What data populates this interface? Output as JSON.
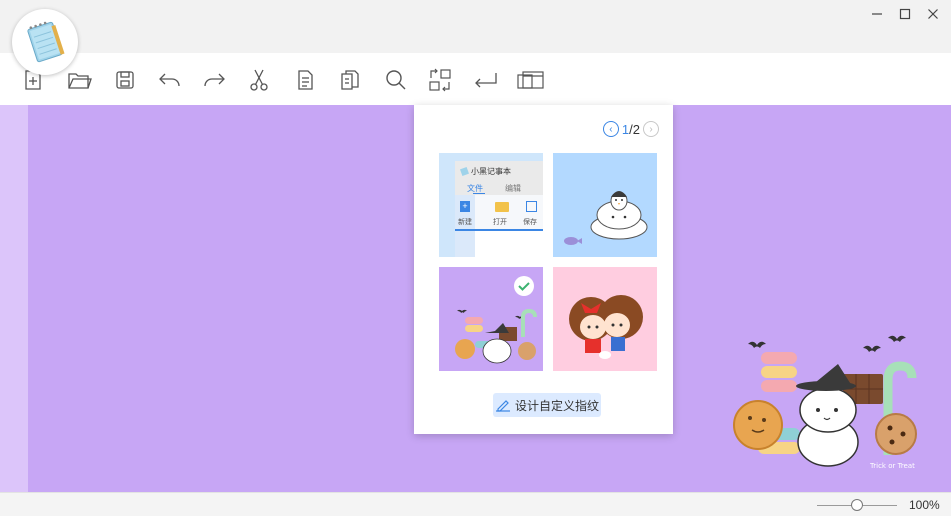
{
  "window": {
    "controls": [
      "minimize",
      "maximize",
      "close"
    ]
  },
  "app": {
    "logo_icon": "notepad-icon"
  },
  "toolbar": {
    "tools": [
      {
        "name": "new-button",
        "icon": "new-file-icon"
      },
      {
        "name": "open-button",
        "icon": "folder-open-icon"
      },
      {
        "name": "save-button",
        "icon": "save-icon"
      },
      {
        "name": "undo-button",
        "icon": "undo-icon"
      },
      {
        "name": "redo-button",
        "icon": "redo-icon"
      },
      {
        "name": "cut-button",
        "icon": "scissors-icon"
      },
      {
        "name": "copy-button",
        "icon": "document-icon"
      },
      {
        "name": "paste-button",
        "icon": "documents-icon"
      },
      {
        "name": "find-button",
        "icon": "search-icon"
      },
      {
        "name": "replace-button",
        "icon": "replace-icon"
      },
      {
        "name": "wrap-button",
        "icon": "enter-icon"
      },
      {
        "name": "skin-button",
        "icon": "windows-icon"
      }
    ]
  },
  "skin_panel": {
    "page": "1/2",
    "page_current": "1",
    "page_total": "/2",
    "thumb1": {
      "title": "小黑记事本",
      "tab_file": "文件",
      "tab_edit": "编辑",
      "btn_new": "新建",
      "btn_open": "打开",
      "btn_save": "保存"
    },
    "selected_index": 2,
    "design_button_label": "设计自定义指纹"
  },
  "editor": {
    "background": "#c7a6f5",
    "gutter": "#dcc5fa",
    "watermark": "Trick or Treat"
  },
  "status": {
    "zoom": "100%",
    "zoom_level": 0.45
  }
}
